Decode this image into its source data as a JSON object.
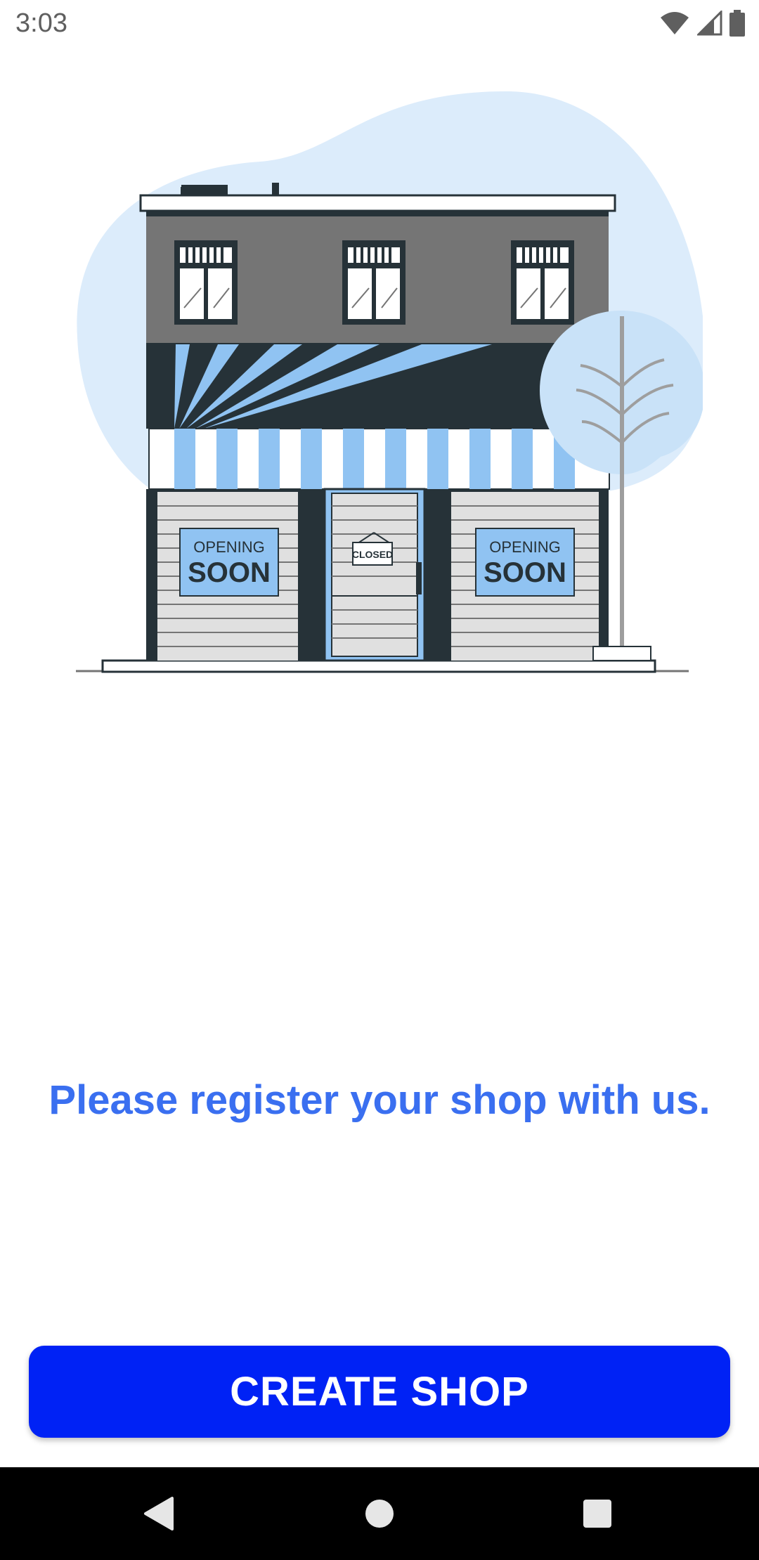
{
  "status_bar": {
    "time": "3:03",
    "icons": [
      "wifi-icon",
      "cellular-signal-icon",
      "battery-icon"
    ]
  },
  "illustration": {
    "sign_left_line1": "OPENING",
    "sign_left_line2": "SOON",
    "sign_right_line1": "OPENING",
    "sign_right_line2": "SOON",
    "door_sign": "CLOSED"
  },
  "main": {
    "message": "Please register your shop with us.",
    "create_shop_label": "CREATE SHOP"
  },
  "nav_bar": {
    "icons": [
      "back-icon",
      "home-icon",
      "recents-icon"
    ]
  },
  "colors": {
    "accent_text": "#3a6ff0",
    "button_bg": "#0022f5",
    "illustration_blue": "#90c3f2",
    "illustration_dark": "#263238",
    "illustration_gray": "#757575"
  }
}
